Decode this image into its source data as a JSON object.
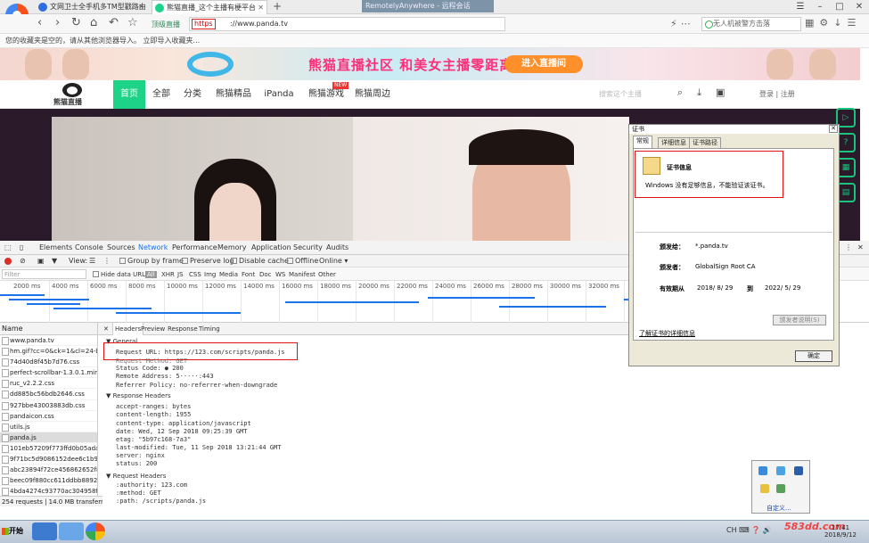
{
  "browser": {
    "tabs": [
      {
        "label": "文网卫士全手机多TM型戳路由"
      },
      {
        "label": "熊猫直播_这个主播有梗平台"
      }
    ],
    "new_tab": "+",
    "remote_title": "RemotelyAnywhere - 远程会话",
    "window_controls": [
      "☰",
      "–",
      "□",
      "✕"
    ],
    "secure_label": "顶级直播",
    "https_label": "https",
    "url": "://www.panda.tv",
    "search_placeholder": "无人机被警方击落",
    "bookmarks_text": "您的收藏夹是空的，请从其他浏览器导入。  立即导入收藏夹..."
  },
  "banner": {
    "headline": "熊猫直播社区 和美女主播零距离！",
    "cta": "进入直播间"
  },
  "site": {
    "logo_text": "熊猫直播",
    "menu": [
      "首页",
      "全部",
      "分类",
      "熊猫精品",
      "iPanda",
      "熊猫游戏",
      "熊猫周边"
    ],
    "new_badge": "NEW",
    "search_placeholder": "搜索这个主播",
    "login": "登录 | 注册"
  },
  "devtools": {
    "tabs": [
      "Elements",
      "Console",
      "Sources",
      "Network",
      "Performance",
      "Memory",
      "Application",
      "Security",
      "Audits"
    ],
    "toolbar": {
      "view": "View:",
      "group_by_frame": "Group by frame",
      "preserve_log": "Preserve log",
      "disable_cache": "Disable cache",
      "offline": "Offline",
      "online": "Online ▾"
    },
    "filter_placeholder": "Filter",
    "hide_data_urls": "Hide data URLs",
    "types": [
      "All",
      "XHR",
      "JS",
      "CSS",
      "Img",
      "Media",
      "Font",
      "Doc",
      "WS",
      "Manifest",
      "Other"
    ],
    "timeline_labels": [
      "2000 ms",
      "4000 ms",
      "6000 ms",
      "8000 ms",
      "10000 ms",
      "12000 ms",
      "14000 ms",
      "16000 ms",
      "18000 ms",
      "20000 ms",
      "22000 ms",
      "24000 ms",
      "26000 ms",
      "28000 ms",
      "30000 ms",
      "32000 ms"
    ],
    "list_header": "Name",
    "requests": [
      "www.panda.tv",
      "hm.gif?cc=0&ck=1&cl=24-bit",
      "74d40d8f45b7d76.css",
      "perfect-scrollbar-1.3.0.1.min.css",
      "ruc_v2.2.2.css",
      "dd885bc56bdb2646.css",
      "927bbe43003883db.css",
      "pandaicon.css",
      "utils.js",
      "panda.js",
      "101eb57209f773ffd0b05ada79c",
      "9f71bc5d9086152dee6c1b9537",
      "abc23894f72ce456862652f8a3",
      "beec09f880cc611ddbb889265a",
      "4bda4274c93770ac304958fb9"
    ],
    "status": "254 requests | 14.0 MB transferred...",
    "detail_tabs": [
      "Headers",
      "Preview",
      "Response",
      "Timing"
    ],
    "general": {
      "title": "▼ General",
      "request_url": "Request URL: https://123.com/scripts/panda.js",
      "request_method": "Request Method: GET",
      "status_code": "Status Code: ● 200",
      "remote_address": "Remote Address: 5·····:443",
      "referrer_policy": "Referrer Policy: no-referrer-when-downgrade"
    },
    "response_headers": {
      "title": "▼ Response Headers",
      "lines": [
        "accept-ranges: bytes",
        "content-length: 1955",
        "content-type: application/javascript",
        "date: Wed, 12 Sep 2018 09:25:39 GMT",
        "etag: \"5b97c168-7a3\"",
        "last-modified: Tue, 11 Sep 2018 13:21:44 GMT",
        "server: nginx",
        "status: 200"
      ]
    },
    "request_headers": {
      "title": "▼ Request Headers",
      "lines": [
        ":authority: 123.com",
        ":method: GET",
        ":path: /scripts/panda.js"
      ]
    }
  },
  "certificate": {
    "title": "证书",
    "tabs": [
      "常规",
      "详细信息",
      "证书路径"
    ],
    "info_title": "证书信息",
    "warning": "Windows 没有足够信息，不能验证该证书。",
    "issued_to_label": "颁发给：",
    "issued_to": "*.panda.tv",
    "issued_by_label": "颁发者：",
    "issued_by": "GlobalSign Root CA",
    "valid_label": "有效期从",
    "valid_from": "2018/ 8/ 29",
    "valid_to_label": "到",
    "valid_to": "2022/ 5/ 29",
    "issuer_statement": "颁发者说明(S)",
    "learn_more": "了解证书的详细信息",
    "ok": "确定"
  },
  "tray": {
    "customize": "自定义..."
  },
  "taskbar": {
    "start": "开始",
    "clock_time": "17:41",
    "clock_date": "2018/9/12",
    "watermark": "583dd.com"
  }
}
